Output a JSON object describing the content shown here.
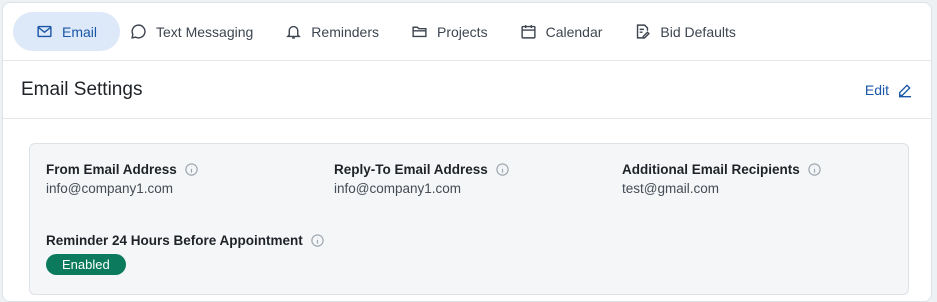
{
  "tabs": [
    {
      "label": "Email",
      "icon": "mail-icon",
      "active": true
    },
    {
      "label": "Text Messaging",
      "icon": "chat-bubble-icon"
    },
    {
      "label": "Reminders",
      "icon": "bell-icon"
    },
    {
      "label": "Projects",
      "icon": "folder-icon"
    },
    {
      "label": "Calendar",
      "icon": "calendar-icon"
    },
    {
      "label": "Bid Defaults",
      "icon": "document-edit-icon"
    }
  ],
  "section": {
    "title": "Email Settings",
    "edit_label": "Edit"
  },
  "fields": {
    "from": {
      "label": "From Email Address",
      "value": "info@company1.com"
    },
    "reply_to": {
      "label": "Reply-To Email Address",
      "value": "info@company1.com"
    },
    "additional": {
      "label": "Additional Email Recipients",
      "value": "test@gmail.com"
    },
    "reminder": {
      "label": "Reminder 24 Hours Before Appointment",
      "status": "Enabled"
    }
  },
  "colors": {
    "accent": "#1a56a8",
    "active_tab_bg": "#dde9f8",
    "badge_bg": "#0c7a5c"
  }
}
